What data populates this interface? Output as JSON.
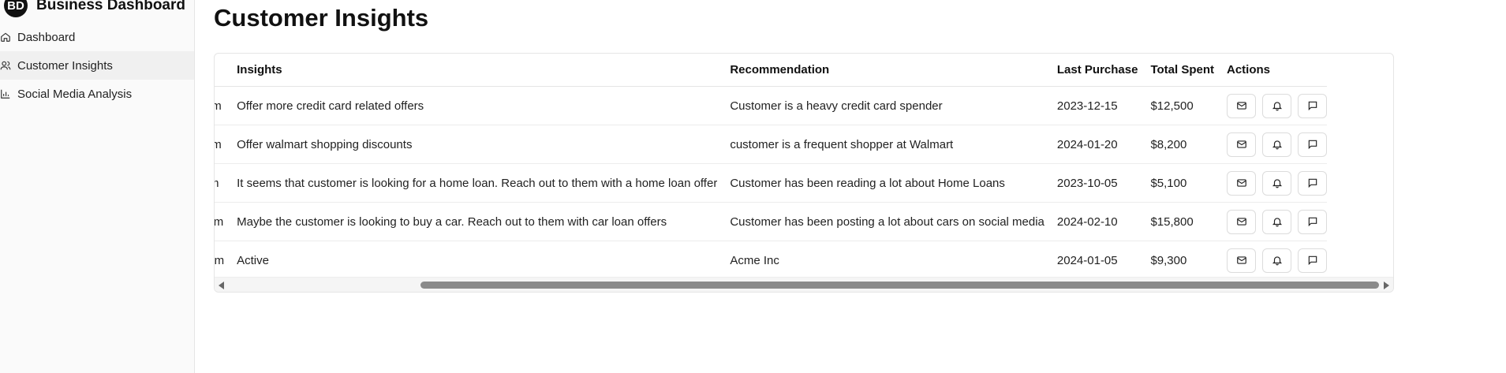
{
  "sidebar": {
    "logo_text": "BD",
    "title": "Business Dashboard",
    "items": [
      {
        "label": "Dashboard",
        "icon": "home-icon"
      },
      {
        "label": "Customer Insights",
        "icon": "users-icon",
        "active": true
      },
      {
        "label": "Social Media Analysis",
        "icon": "bar-chart-icon"
      }
    ]
  },
  "page": {
    "title": "Customer Insights"
  },
  "table": {
    "columns": [
      "Insights",
      "Recommendation",
      "Last Purchase",
      "Total Spent",
      "Actions"
    ],
    "rows": [
      {
        "email": "john@example.com",
        "insight": "Offer more credit card related offers",
        "recommendation": "Customer is a heavy credit card spender",
        "last_purchase": "2023-12-15",
        "total_spent": "$12,500"
      },
      {
        "email": "jane@example.com",
        "insight": "Offer walmart shopping discounts",
        "recommendation": "customer is a frequent shopper at Walmart",
        "last_purchase": "2024-01-20",
        "total_spent": "$8,200"
      },
      {
        "email": "bob@example.com",
        "insight": "It seems that customer is looking for a home loan. Reach out to them with a home loan offer",
        "recommendation": "Customer has been reading a lot about Home Loans",
        "last_purchase": "2023-10-05",
        "total_spent": "$5,100"
      },
      {
        "email": "alice@example.com",
        "insight": "Maybe the customer is looking to buy a car. Reach out to them with car loan offers",
        "recommendation": "Customer has been posting a lot about cars on social media",
        "last_purchase": "2024-02-10",
        "total_spent": "$15,800"
      },
      {
        "email": "mike@example.com",
        "insight": "Active",
        "recommendation": "Acme Inc",
        "last_purchase": "2024-01-05",
        "total_spent": "$9,300"
      }
    ],
    "actions": [
      "mail-icon",
      "bell-icon",
      "message-icon"
    ]
  },
  "colors": {
    "text": "#111111",
    "border": "#e5e5e5",
    "sidebar_bg": "#fafafa",
    "active_bg": "#f0f0f0",
    "scroll_thumb": "#8a8a8a"
  }
}
